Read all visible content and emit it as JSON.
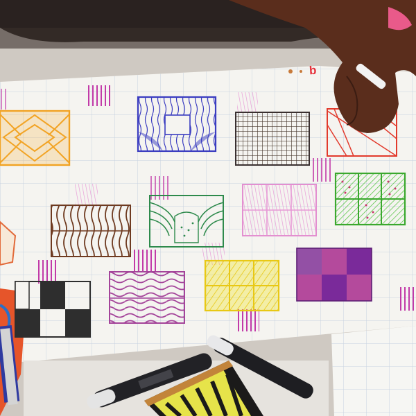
{
  "page_mark": "b",
  "colors": {
    "paper": "#f5f4f0",
    "grid": "#c7d2e0",
    "orange": "#f0a01e",
    "blue": "#3a3cc0",
    "black": "#2e2e2e",
    "red": "#e23a2c",
    "pink": "#d86ac6",
    "brown": "#6e3a20",
    "green_dark": "#2e8a4c",
    "green_light": "#4cc23a",
    "purple": "#7a2a9a",
    "yellow": "#f2e21c",
    "skin": "#5a2d1c"
  },
  "scene": {
    "objects": [
      "grid-paper-sheet",
      "pattern-squares",
      "drawing-hand",
      "marker-set",
      "spiral-notebook",
      "extra-grid-sheet"
    ]
  }
}
